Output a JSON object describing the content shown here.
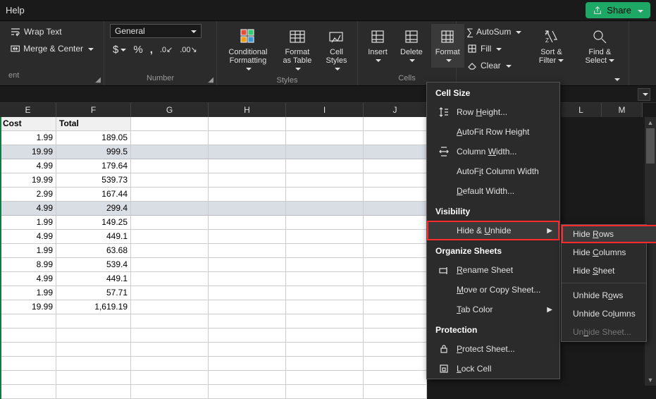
{
  "titlebar": {
    "help": "Help",
    "share": "Share"
  },
  "ribbon": {
    "alignment": {
      "wrap": "Wrap Text",
      "merge": "Merge & Center",
      "ent": "ent"
    },
    "number": {
      "format": "General",
      "label": "Number"
    },
    "styles": {
      "cond": "Conditional\nFormatting",
      "fmtTable": "Format as\nTable",
      "cellStyles": "Cell\nStyles",
      "label": "Styles"
    },
    "cells": {
      "insert": "Insert",
      "delete": "Delete",
      "format": "Format",
      "label": "Cells"
    },
    "editing": {
      "autosum": "AutoSum",
      "fill": "Fill",
      "clear": "Clear",
      "sort": "Sort &\nFilter",
      "find": "Find &\nSelect"
    }
  },
  "columns": [
    "E",
    "F",
    "G",
    "H",
    "I",
    "J",
    "L",
    "M"
  ],
  "headerRow": {
    "E": "Cost",
    "F": "Total"
  },
  "chart_data": {
    "type": "table",
    "columns": [
      "Cost",
      "Total"
    ],
    "rows": [
      {
        "Cost": 1.99,
        "Total": 189.05,
        "selected": false
      },
      {
        "Cost": 19.99,
        "Total": 999.5,
        "selected": true
      },
      {
        "Cost": 4.99,
        "Total": 179.64,
        "selected": false
      },
      {
        "Cost": 19.99,
        "Total": 539.73,
        "selected": false
      },
      {
        "Cost": 2.99,
        "Total": 167.44,
        "selected": false
      },
      {
        "Cost": 4.99,
        "Total": 299.4,
        "selected": true
      },
      {
        "Cost": 1.99,
        "Total": 149.25,
        "selected": false
      },
      {
        "Cost": 4.99,
        "Total": 449.1,
        "selected": false
      },
      {
        "Cost": 1.99,
        "Total": 63.68,
        "selected": false
      },
      {
        "Cost": 8.99,
        "Total": 539.4,
        "selected": false
      },
      {
        "Cost": 4.99,
        "Total": 449.1,
        "selected": false
      },
      {
        "Cost": 1.99,
        "Total": 57.71,
        "selected": false
      },
      {
        "Cost": 19.99,
        "Total": 1619.19,
        "selected": false
      }
    ]
  },
  "menu1": {
    "cellSize": "Cell Size",
    "rowHeight": "Row Height...",
    "autofitRowH": "AutoFit Row Height",
    "colWidth": "Column Width...",
    "autofitColW": "AutoFit Column Width",
    "defaultW": "Default Width...",
    "visibility": "Visibility",
    "hideUnhide": "Hide & Unhide",
    "orgSheets": "Organize Sheets",
    "rename": "Rename Sheet",
    "moveCopy": "Move or Copy Sheet...",
    "tabColor": "Tab Color",
    "protection": "Protection",
    "protectSheet": "Protect Sheet...",
    "lockCell": "Lock Cell"
  },
  "menu2": {
    "hideRows": "Hide Rows",
    "hideCols": "Hide Columns",
    "hideSheet": "Hide Sheet",
    "unhideRows": "Unhide Rows",
    "unhideCols": "Unhide Columns",
    "unhideSheet": "Unhide Sheet..."
  },
  "formats": {
    "cost": [
      "1.99",
      "19.99",
      "4.99",
      "19.99",
      "2.99",
      "4.99",
      "1.99",
      "4.99",
      "1.99",
      "8.99",
      "4.99",
      "1.99",
      "19.99"
    ],
    "total": [
      "189.05",
      "999.5",
      "179.64",
      "539.73",
      "167.44",
      "299.4",
      "149.25",
      "449.1",
      "63.68",
      "539.4",
      "449.1",
      "57.71",
      "1,619.19"
    ]
  }
}
